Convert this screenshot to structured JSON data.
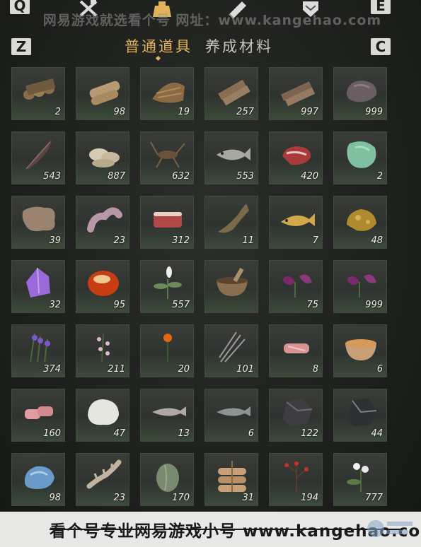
{
  "hotkeys": {
    "left_tab": "Q",
    "right_tab": "E",
    "left_sub": "Z",
    "right_sub": "C"
  },
  "watermark": {
    "top": "网易游戏就选看个号 网址：www.kangehao.com",
    "bottom": "看个号专业网易游戏小号 www.kangehao.com"
  },
  "tabs": [
    {
      "label": "普通道具",
      "active": true
    },
    {
      "label": "养成材料",
      "active": false
    }
  ],
  "top_icons": [
    "crossed-tools-icon",
    "item-bag-icon",
    "scroll-icon",
    "badge-icon"
  ],
  "items": [
    {
      "icon": "log-bundle-icon",
      "count": "2"
    },
    {
      "icon": "logs-icon",
      "count": "98"
    },
    {
      "icon": "bark-fiber-icon",
      "count": "19"
    },
    {
      "icon": "wood-stack-icon",
      "count": "257"
    },
    {
      "icon": "wood-pile-icon",
      "count": "997"
    },
    {
      "icon": "stone-icon",
      "count": "999"
    },
    {
      "icon": "feather-icon",
      "count": "543"
    },
    {
      "icon": "mushroom-icon",
      "count": "887"
    },
    {
      "icon": "cricket-icon",
      "count": "632"
    },
    {
      "icon": "fish-icon",
      "count": "553"
    },
    {
      "icon": "raw-meat-icon",
      "count": "420"
    },
    {
      "icon": "jade-icon",
      "count": "2"
    },
    {
      "icon": "animal-hide-icon",
      "count": "39"
    },
    {
      "icon": "intestine-icon",
      "count": "23"
    },
    {
      "icon": "meat-slab-icon",
      "count": "312"
    },
    {
      "icon": "leaping-fish-icon",
      "count": "11"
    },
    {
      "icon": "golden-carp-icon",
      "count": "7"
    },
    {
      "icon": "gold-ore-icon",
      "count": "48"
    },
    {
      "icon": "amethyst-icon",
      "count": "32"
    },
    {
      "icon": "amber-stone-icon",
      "count": "95"
    },
    {
      "icon": "white-herb-icon",
      "count": "557"
    },
    {
      "icon": "mortar-bowl-icon",
      "count": ""
    },
    {
      "icon": "purple-flower-icon",
      "count": "75"
    },
    {
      "icon": "purple-flower-icon",
      "count": "999"
    },
    {
      "icon": "lavender-icon",
      "count": "374"
    },
    {
      "icon": "pink-blossom-icon",
      "count": "211"
    },
    {
      "icon": "orange-flower-icon",
      "count": "20"
    },
    {
      "icon": "grey-grass-icon",
      "count": "101"
    },
    {
      "icon": "sliced-meat-icon",
      "count": "8"
    },
    {
      "icon": "soup-bowl-icon",
      "count": "6"
    },
    {
      "icon": "meat-cuts-icon",
      "count": "160"
    },
    {
      "icon": "wool-icon",
      "count": "47"
    },
    {
      "icon": "small-fish-icon",
      "count": "13"
    },
    {
      "icon": "grey-fish-icon",
      "count": "6"
    },
    {
      "icon": "iron-ore-icon",
      "count": "122"
    },
    {
      "icon": "dark-ore-icon",
      "count": "44"
    },
    {
      "icon": "blue-crystal-icon",
      "count": "98"
    },
    {
      "icon": "bone-icon",
      "count": "23"
    },
    {
      "icon": "melon-icon",
      "count": "170"
    },
    {
      "icon": "bundled-pouches-icon",
      "count": "31"
    },
    {
      "icon": "red-berry-branch-icon",
      "count": "194"
    },
    {
      "icon": "white-flower-icon",
      "count": "777"
    }
  ]
}
